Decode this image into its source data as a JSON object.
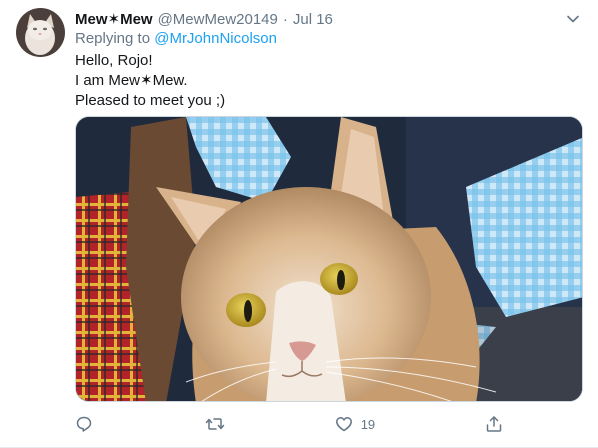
{
  "tweet": {
    "display_name": "Mew✶Mew",
    "handle": "@MewMew20149",
    "separator": "·",
    "date": "Jul 16",
    "replying_prefix": "Replying to ",
    "replying_to": "@MrJohnNicolson",
    "lines": [
      "Hello, Rojo!",
      "I am Mew✶Mew.",
      "Pleased to meet you ;)"
    ],
    "media_alt": "cat photo",
    "like_count": "19"
  },
  "icons": {
    "menu": "chevron-down-icon",
    "reply": "reply-icon",
    "retweet": "retweet-icon",
    "like": "heart-icon",
    "share": "share-icon"
  },
  "colors": {
    "link": "#1da1f2",
    "secondary_text": "#657786",
    "primary_text": "#14171a"
  }
}
